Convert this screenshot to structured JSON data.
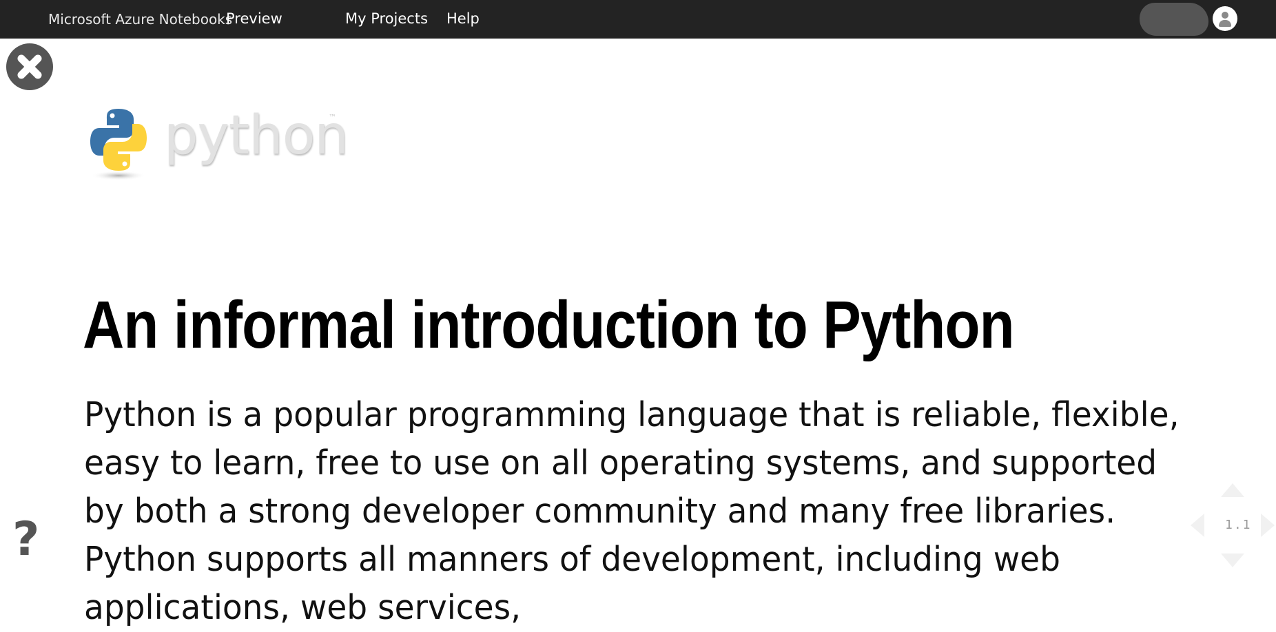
{
  "header": {
    "brand": "Microsoft Azure Notebooks",
    "preview": "Preview",
    "nav": [
      {
        "label": "My Projects"
      },
      {
        "label": "Help"
      }
    ]
  },
  "logo": {
    "word": "python",
    "tm": "™"
  },
  "slide": {
    "title": "An informal introduction to Python",
    "body": "Python is a popular programming language that is reliable, flexible, easy to learn, free to use on all operating systems, and supported by both a strong developer community and many free libraries. Python supports all manners of development, including web applications, web services,"
  },
  "controls": {
    "help_glyph": "?",
    "slide_number": "1.1"
  },
  "colors": {
    "topbar": "#232323",
    "control_gray": "#555555",
    "python_blue": "#3a73a8",
    "python_yellow": "#fdd23b"
  }
}
